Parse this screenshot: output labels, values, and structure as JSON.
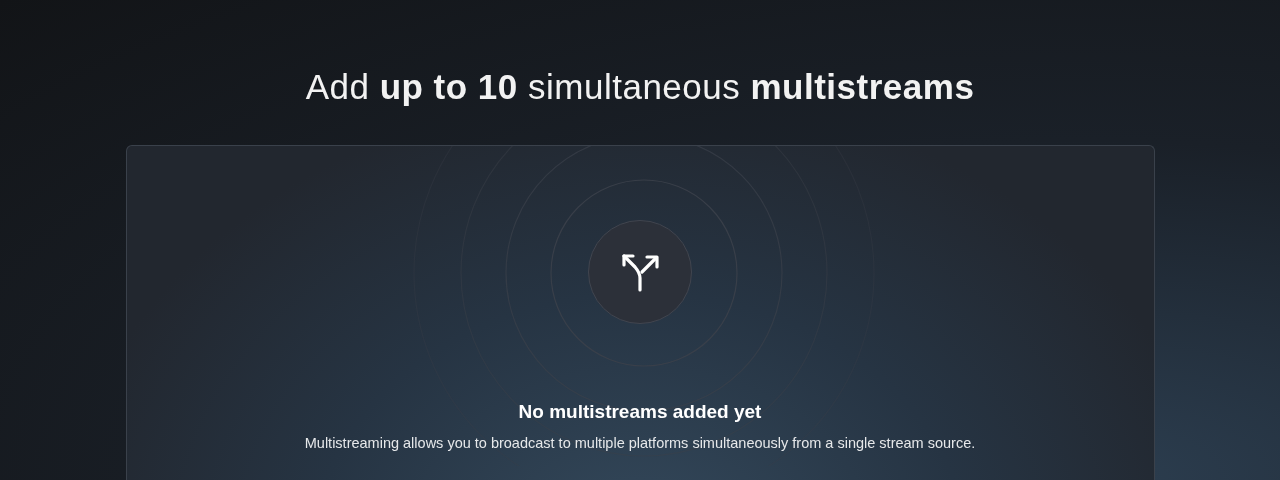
{
  "headline": "Add **up to 10** simultaneous **multistreams**",
  "empty_state": {
    "title": "No multistreams added yet",
    "description": "Multistreaming allows you to broadcast to multiple platforms simultaneously from a single stream source."
  }
}
